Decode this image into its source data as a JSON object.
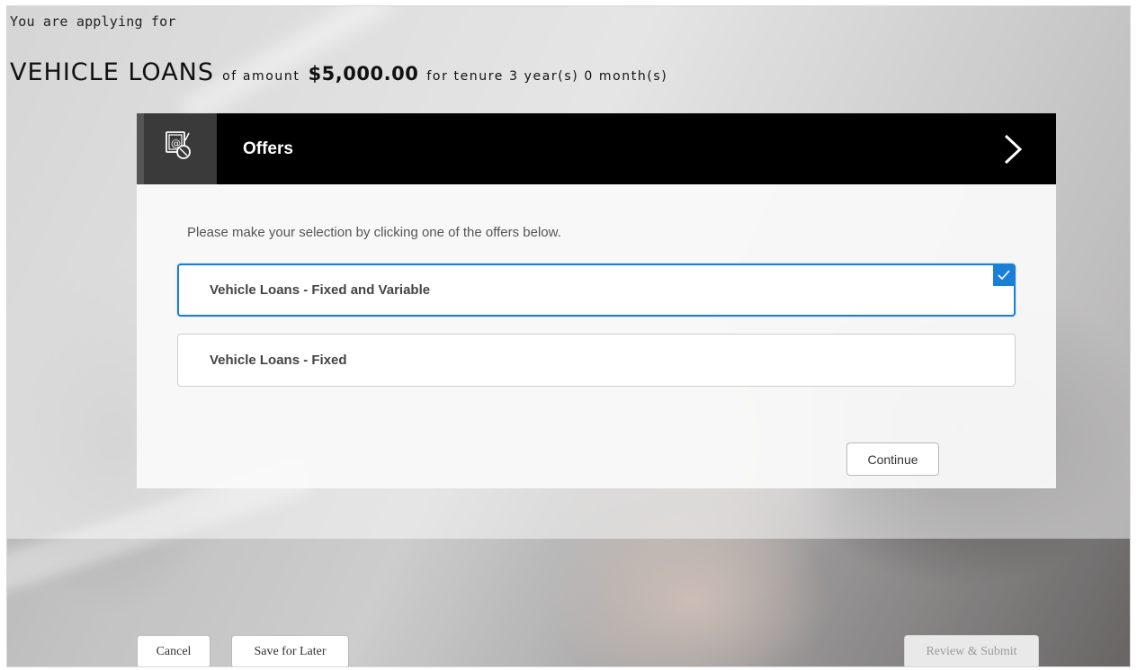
{
  "application": {
    "intro": "You are applying for",
    "product": "VEHICLE LOANS",
    "amount_prefix": "of amount",
    "amount": "$5,000.00",
    "tenure_text": "for tenure 3 year(s) 0 month(s)"
  },
  "offers_panel": {
    "title": "Offers",
    "instruction": "Please make your selection by clicking one of the offers below.",
    "offers": [
      {
        "label": "Vehicle Loans - Fixed and Variable",
        "selected": true
      },
      {
        "label": "Vehicle Loans - Fixed",
        "selected": false
      }
    ],
    "continue_label": "Continue"
  },
  "footer": {
    "cancel_label": "Cancel",
    "save_label": "Save for Later",
    "review_label": "Review & Submit"
  },
  "colors": {
    "accent": "#1b7fd8",
    "header_bg": "#000000"
  },
  "icons": {
    "header": "offers-icon",
    "next": "chevron-right-icon",
    "selected": "checkmark-icon"
  }
}
